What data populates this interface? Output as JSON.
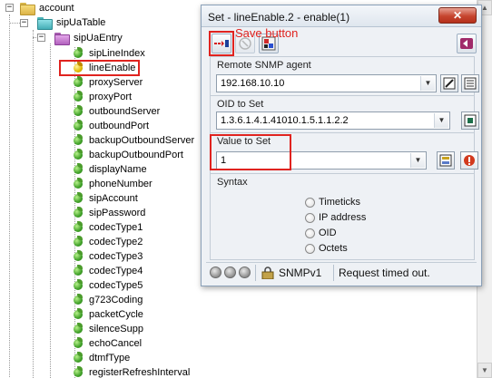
{
  "tree": {
    "account": "account",
    "table": "sipUaTable",
    "entry": "sipUaEntry",
    "leaves": [
      "sipLineIndex",
      "lineEnable",
      "proxyServer",
      "proxyPort",
      "outboundServer",
      "outboundPort",
      "backupOutboundServer",
      "backupOutboundPort",
      "displayName",
      "phoneNumber",
      "sipAccount",
      "sipPassword",
      "codecType1",
      "codecType2",
      "codecType3",
      "codecType4",
      "codecType5",
      "g723Coding",
      "packetCycle",
      "silenceSupp",
      "echoCancel",
      "dtmfType",
      "registerRefreshInterval"
    ],
    "expand_minus": "−"
  },
  "dialog": {
    "title": "Set - lineEnable.2 - enable(1)",
    "close": "✕",
    "annotation": "Save button",
    "agent_label": "Remote SNMP agent",
    "agent_value": "192.168.10.10",
    "oid_label": "OID to Set",
    "oid_value": "1.3.6.1.4.1.41010.1.5.1.1.2.2",
    "value_label": "Value to Set",
    "value_value": "1",
    "syntax_label": "Syntax",
    "syntax_options": [
      "Timeticks",
      "IP address",
      "OID",
      "Octets"
    ],
    "status_version": "SNMPv1",
    "status_message": "Request timed out."
  },
  "colors": {
    "highlight": "#e0231f",
    "accent": "#3a6ea5"
  }
}
